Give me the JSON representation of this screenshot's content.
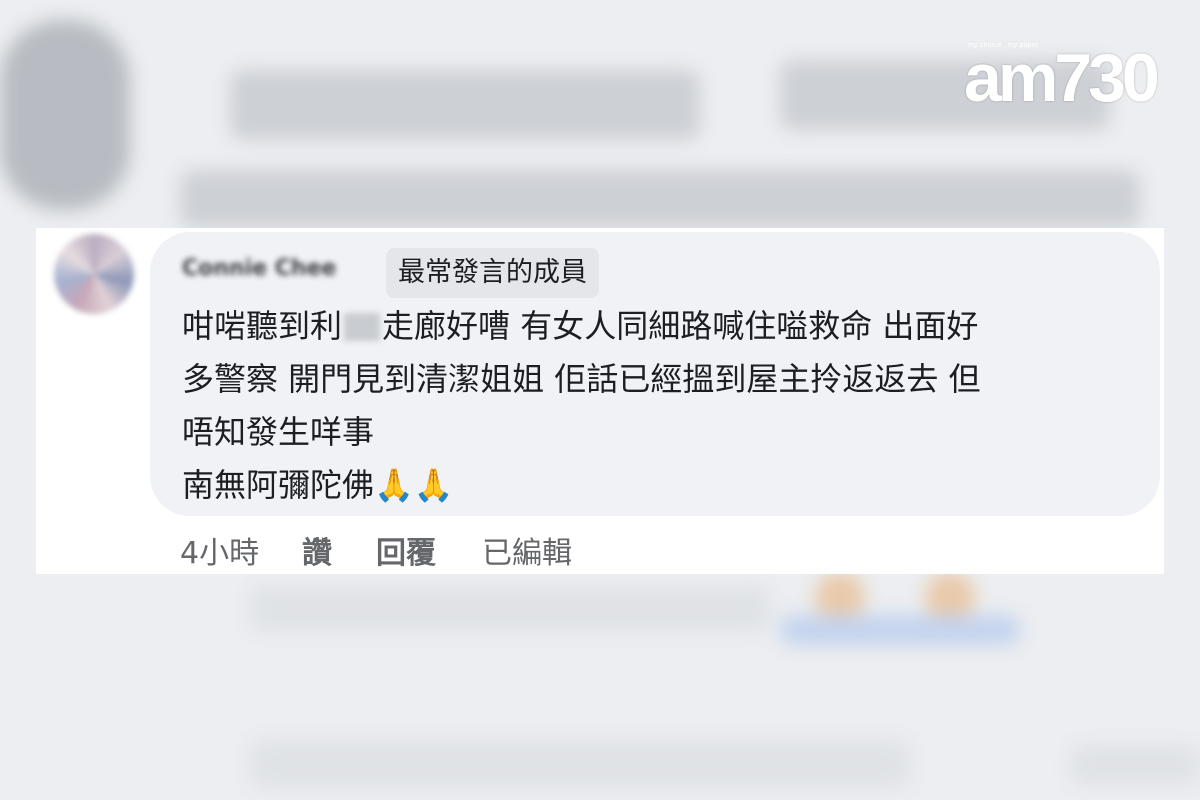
{
  "logo": {
    "tagline": "my choice . my paper",
    "text": "am730"
  },
  "comment": {
    "author": "Connie Chee",
    "badge": "最常發言的成員",
    "message_lines": [
      {
        "before": "咁啱聽到利",
        "after": "走廊好嘈 有女人同細路喊住嗌救命 出面好"
      },
      {
        "text": "多警察 開門見到清潔姐姐 佢話已經搵到屋主拎返返去 但"
      },
      {
        "text": "唔知發生咩事"
      },
      {
        "text": "南無阿彌陀佛🙏🙏"
      }
    ],
    "time": "4小時",
    "like_label": "讚",
    "reply_label": "回覆",
    "edited_label": "已編輯"
  }
}
